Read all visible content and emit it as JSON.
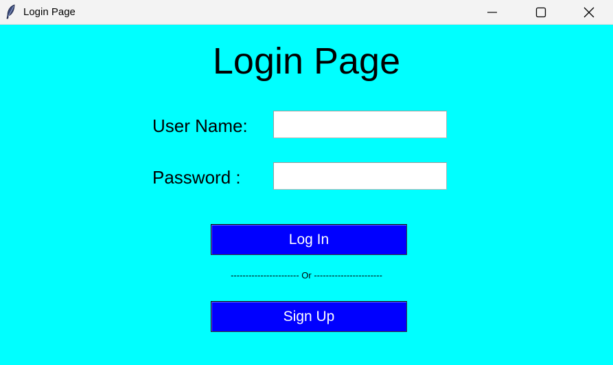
{
  "window": {
    "title": "Login Page",
    "app_icon": "feather-icon",
    "controls": {
      "minimize_icon": "minimize-icon",
      "maximize_icon": "maximize-icon",
      "close_icon": "close-icon"
    },
    "background_color": "#00ffff"
  },
  "form": {
    "heading": "Login Page",
    "username_label": "User Name:",
    "username_value": "",
    "password_label": "Password :",
    "password_value": "",
    "login_button": "Log In",
    "divider_text": "----------------------- Or -----------------------",
    "signup_button": "Sign Up",
    "button_color": "#0000ff",
    "button_text_color": "#ffffff"
  }
}
